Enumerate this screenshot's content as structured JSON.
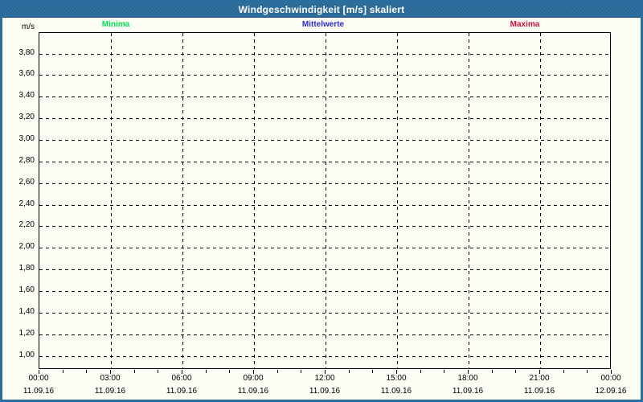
{
  "window": {
    "title": "Windgeschwindigkeit [m/s] skaliert"
  },
  "colors": {
    "titlebar_bg": "#2a6d9e",
    "window_border": "#2a6d9e",
    "background": "#fcfdf5",
    "grid": "#000000",
    "minima": "#00e052",
    "mittelwerte": "#2b2bd6",
    "maxima": "#cd1039"
  },
  "legend": {
    "items": [
      {
        "label": "Minima",
        "color_key": "minima"
      },
      {
        "label": "Mittelwerte",
        "color_key": "mittelwerte"
      },
      {
        "label": "Maxima",
        "color_key": "maxima"
      }
    ]
  },
  "chart_data": {
    "type": "line",
    "title": "Windgeschwindigkeit [m/s] skaliert",
    "ylabel": "m/s",
    "ylim": [
      0.87,
      3.99
    ],
    "grid": "dashed",
    "y_ticks": [
      {
        "value": 3.8,
        "label": "3,80"
      },
      {
        "value": 3.6,
        "label": "3,60"
      },
      {
        "value": 3.4,
        "label": "3,40"
      },
      {
        "value": 3.2,
        "label": "3,20"
      },
      {
        "value": 3.0,
        "label": "3,00"
      },
      {
        "value": 2.8,
        "label": "2,80"
      },
      {
        "value": 2.6,
        "label": "2,60"
      },
      {
        "value": 2.4,
        "label": "2,40"
      },
      {
        "value": 2.2,
        "label": "2,20"
      },
      {
        "value": 2.0,
        "label": "2,00"
      },
      {
        "value": 1.8,
        "label": "1,80"
      },
      {
        "value": 1.6,
        "label": "1,60"
      },
      {
        "value": 1.4,
        "label": "1,40"
      },
      {
        "value": 1.2,
        "label": "1,20"
      },
      {
        "value": 1.0,
        "label": "1,00"
      }
    ],
    "x_range_hours": [
      0,
      24
    ],
    "x_minor_step_hours": 1,
    "x_major_ticks": [
      {
        "hour": 0,
        "time": "00:00",
        "date": "11.09.16"
      },
      {
        "hour": 3,
        "time": "03:00",
        "date": "11.09.16"
      },
      {
        "hour": 6,
        "time": "06:00",
        "date": "11.09.16"
      },
      {
        "hour": 9,
        "time": "09:00",
        "date": "11.09.16"
      },
      {
        "hour": 12,
        "time": "12:00",
        "date": "11.09.16"
      },
      {
        "hour": 15,
        "time": "15:00",
        "date": "11.09.16"
      },
      {
        "hour": 18,
        "time": "18:00",
        "date": "11.09.16"
      },
      {
        "hour": 21,
        "time": "21:00",
        "date": "11.09.16"
      },
      {
        "hour": 24,
        "time": "00:00",
        "date": "12.09.16"
      }
    ],
    "series": [
      {
        "name": "Minima",
        "color": "#00e052",
        "values": []
      },
      {
        "name": "Mittelwerte",
        "color": "#2b2bd6",
        "values": []
      },
      {
        "name": "Maxima",
        "color": "#cd1039",
        "values": []
      }
    ]
  }
}
